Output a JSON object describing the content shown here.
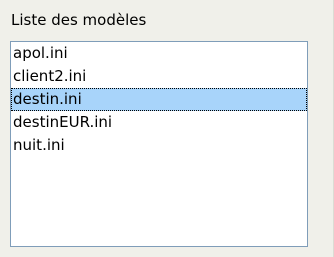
{
  "group": {
    "label": "Liste des modèles"
  },
  "list": {
    "items": [
      {
        "label": "apol.ini"
      },
      {
        "label": "client2.ini"
      },
      {
        "label": "destin.ini"
      },
      {
        "label": "destinEUR.ini"
      },
      {
        "label": "nuit.ini"
      }
    ],
    "selected_label": "destin.ini"
  },
  "colors": {
    "panel_bg": "#f0f0ea",
    "list_border": "#7f9db9",
    "selection_bg": "#a8d4fa"
  }
}
